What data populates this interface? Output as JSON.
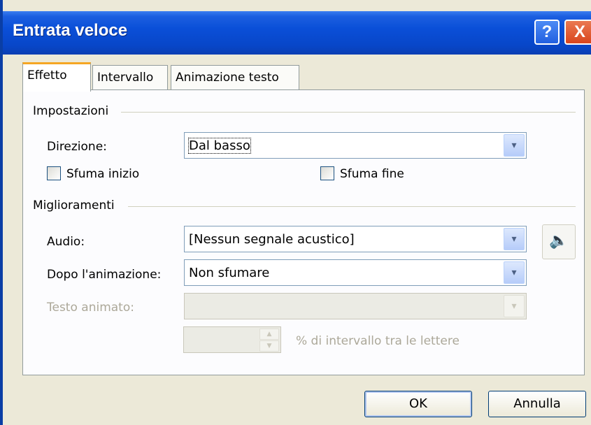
{
  "window": {
    "title": "Entrata veloce",
    "help_glyph": "?",
    "close_glyph": "X"
  },
  "tabs": [
    {
      "label": "Effetto",
      "active": true
    },
    {
      "label": "Intervallo",
      "active": false
    },
    {
      "label": "Animazione testo",
      "active": false
    }
  ],
  "impostazioni": {
    "group_label": "Impostazioni",
    "direzione_label": "Direzione:",
    "direzione_value": "Dal basso",
    "sfuma_inizio_label": "Sfuma inizio",
    "sfuma_inizio_checked": false,
    "sfuma_fine_label": "Sfuma fine",
    "sfuma_fine_checked": false
  },
  "miglioramenti": {
    "group_label": "Miglioramenti",
    "audio_label": "Audio:",
    "audio_value": "[Nessun segnale acustico]",
    "dopo_label": "Dopo l'animazione:",
    "dopo_value": "Non sfumare",
    "testo_label": "Testo animato:",
    "testo_value": "",
    "intervallo_label": "% di intervallo tra le lettere",
    "intervallo_value": ""
  },
  "icons": {
    "arrow": "▾",
    "speaker": "🔈",
    "spin_up": "▲",
    "spin_down": "▼"
  },
  "buttons": {
    "ok": "OK",
    "cancel": "Annulla"
  },
  "colors": {
    "titlebar": "#0a4fd8",
    "active_tab_accent": "#f5a623",
    "close_button": "#d9451d"
  }
}
